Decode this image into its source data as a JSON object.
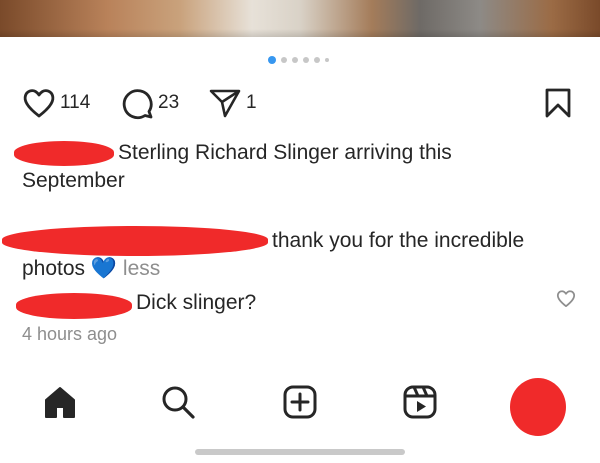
{
  "post": {
    "carousel": {
      "current_index": 1,
      "total": 6
    },
    "likes": "114",
    "comments": "23",
    "shares": "1",
    "caption_text_line1": "Sterling Richard Slinger arriving this",
    "caption_text_line2": "September"
  },
  "comments": [
    {
      "text_line1": "thank you for the incredible",
      "text_line2": "photos",
      "emoji": "💙",
      "toggle_label": "less"
    },
    {
      "text": "Dick slinger?",
      "time_label": "4 hours ago"
    }
  ],
  "nav": {
    "items": [
      "home-icon",
      "search-icon",
      "create-icon",
      "reels-icon",
      "profile-avatar"
    ]
  },
  "colors": {
    "redaction": "#f02a2a",
    "accent": "#3797f0",
    "muted": "#8e8e8e"
  }
}
